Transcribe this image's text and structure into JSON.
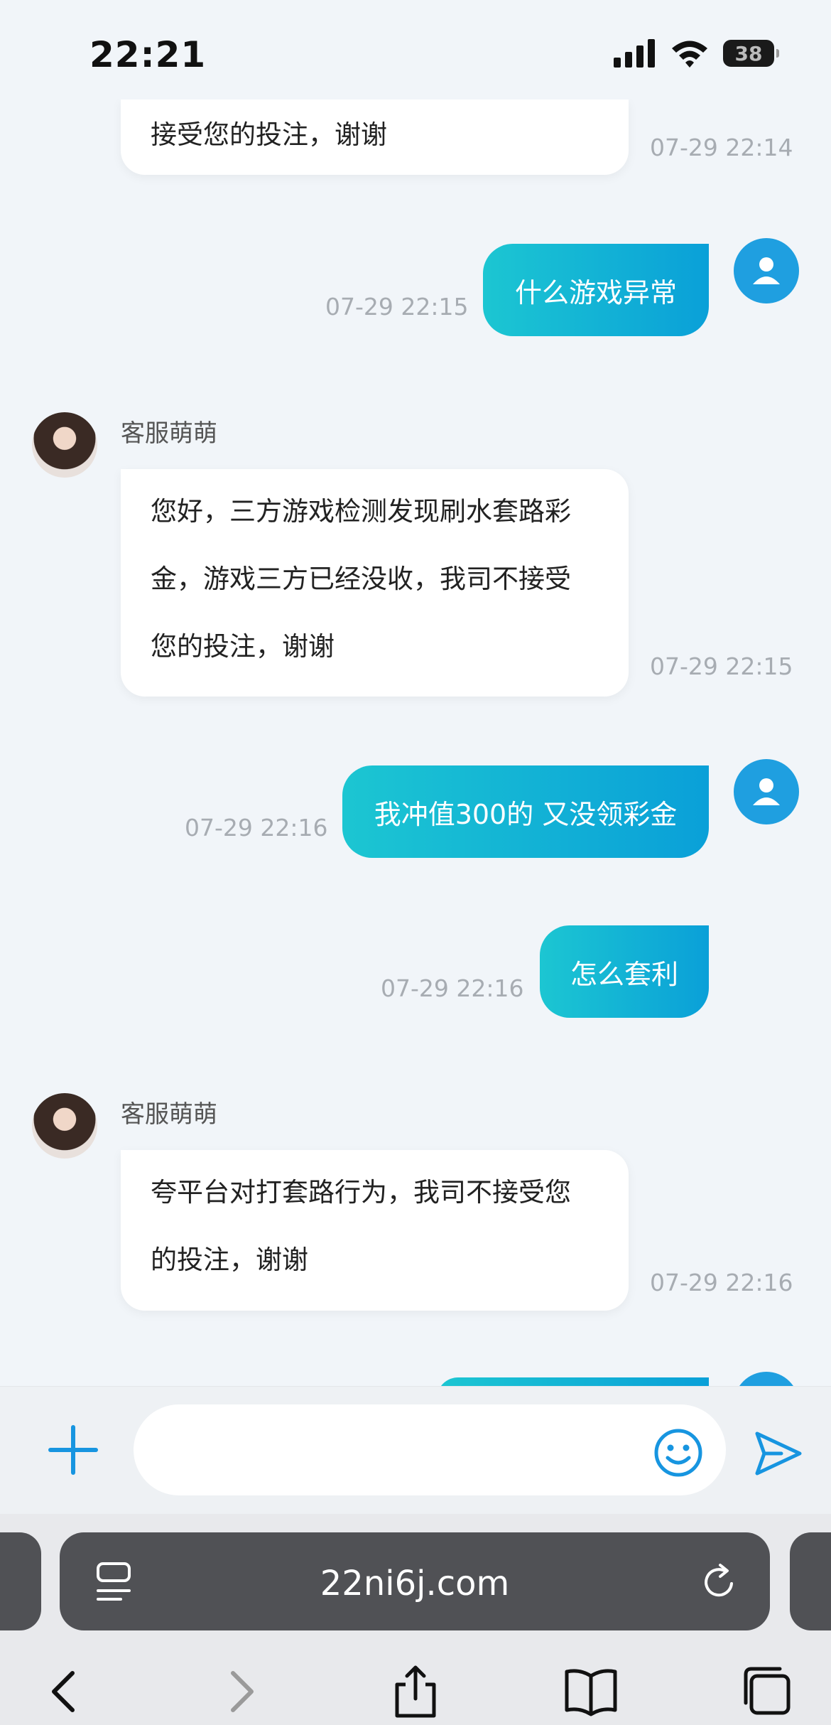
{
  "status_bar": {
    "time": "22:21",
    "battery": "38"
  },
  "messages": {
    "m0": {
      "text": "接受您的投注，谢谢",
      "time": "07-29 22:14"
    },
    "m1": {
      "text": "什么游戏异常",
      "time": "07-29 22:15"
    },
    "m2": {
      "sender": "客服萌萌",
      "line1": "您好，三方游戏检测发现刷水套路彩",
      "line2": "金，游戏三方已经没收，我司不接受",
      "line3": "您的投注，谢谢",
      "time": "07-29 22:15"
    },
    "m3": {
      "text": "我冲值300的 又没领彩金",
      "time": "07-29 22:16"
    },
    "m4": {
      "text": "怎么套利",
      "time": "07-29 22:16"
    },
    "m5": {
      "sender": "客服萌萌",
      "line1": "夸平台对打套路行为，我司不接受您",
      "line2": "的投注，谢谢",
      "time": "07-29 22:16"
    }
  },
  "composer": {
    "placeholder": "",
    "value": ""
  },
  "browser": {
    "url": "22ni6j.com"
  },
  "icons": {
    "add": "plus-icon",
    "emoji": "smiley-icon",
    "send": "send-icon",
    "reader": "reader-icon",
    "reload": "reload-icon",
    "back": "back-icon",
    "forward": "forward-icon",
    "share": "share-icon",
    "bookmarks": "bookmarks-icon",
    "tabs": "tabs-icon"
  },
  "colors": {
    "accent": "#1795e0",
    "outgoing_start": "#1cc6d2",
    "outgoing_end": "#0aa0d8"
  }
}
